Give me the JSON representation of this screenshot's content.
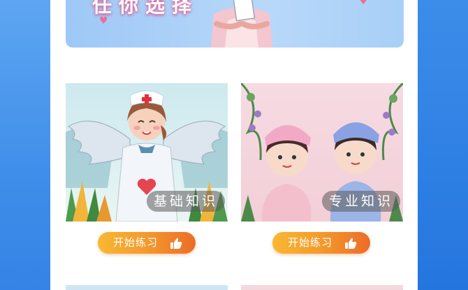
{
  "banner": {
    "title": "任你选择"
  },
  "cards": [
    {
      "badge": "基础知识",
      "button": "开始练习",
      "icon": "thumb-point-icon"
    },
    {
      "badge": "专业知识",
      "button": "开始练习",
      "icon": "thumb-point-icon"
    }
  ],
  "colors": {
    "button_start": "#f8b733",
    "button_end": "#ec6c28",
    "side": "#3a86e8"
  }
}
